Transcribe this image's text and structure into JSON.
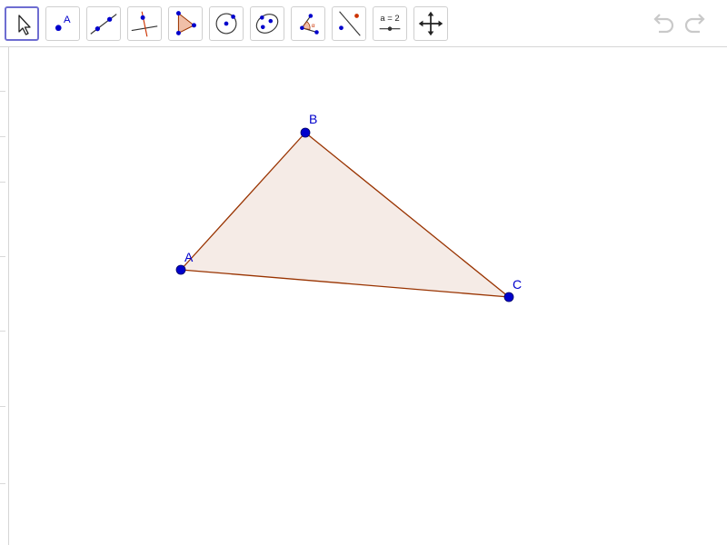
{
  "toolbar": {
    "tools": [
      {
        "id": "move",
        "icon": "arrow-cursor-icon",
        "selected": true
      },
      {
        "id": "point",
        "icon": "point-icon",
        "icon_text": "A"
      },
      {
        "id": "line",
        "icon": "line-through-points-icon"
      },
      {
        "id": "perpendicular",
        "icon": "perpendicular-line-icon"
      },
      {
        "id": "polygon",
        "icon": "polygon-icon"
      },
      {
        "id": "circle",
        "icon": "circle-center-point-icon"
      },
      {
        "id": "conic",
        "icon": "ellipse-icon"
      },
      {
        "id": "angle",
        "icon": "angle-icon"
      },
      {
        "id": "reflect",
        "icon": "reflect-about-line-icon"
      },
      {
        "id": "slider",
        "icon": "slider-icon",
        "icon_text": "a = 2"
      },
      {
        "id": "move-graphics",
        "icon": "move-graphics-view-icon"
      }
    ],
    "undo_icon": "undo-icon",
    "redo_icon": "redo-icon"
  },
  "construction": {
    "points": [
      {
        "label": "A"
      },
      {
        "label": "B"
      },
      {
        "label": "C"
      }
    ],
    "colors": {
      "point_fill": "#0000cc",
      "polygon_stroke": "#993300",
      "polygon_fill": "#f5ebe6",
      "label": "#0000cc",
      "tool_selected_border": "#6e6dd1"
    }
  }
}
